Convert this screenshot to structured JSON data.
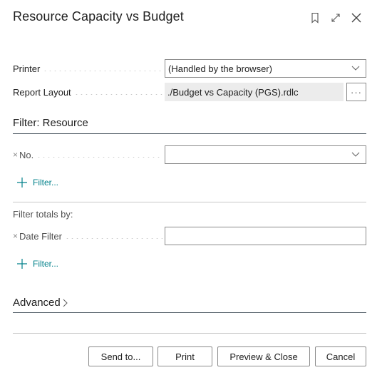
{
  "dialog": {
    "title": "Resource Capacity vs Budget",
    "header_icons": [
      "bookmark-icon",
      "expand-icon",
      "close-icon"
    ]
  },
  "options": {
    "printer": {
      "label": "Printer",
      "value": "(Handled by the browser)"
    },
    "report_layout": {
      "label": "Report Layout",
      "value": "./Budget vs Capacity (PGS).rdlc",
      "action_label": "···"
    }
  },
  "filter_resource": {
    "title": "Filter: Resource",
    "fields": [
      {
        "remove_glyph": "×",
        "label": "No.",
        "value": ""
      }
    ],
    "add_filter_label": "Filter..."
  },
  "filter_totals": {
    "title": "Filter totals by:",
    "fields": [
      {
        "remove_glyph": "×",
        "label": "Date Filter",
        "value": ""
      }
    ],
    "add_filter_label": "Filter..."
  },
  "advanced": {
    "title": "Advanced",
    "chevron": "›"
  },
  "footer": {
    "send_to": "Send to...",
    "print": "Print",
    "preview_close": "Preview & Close",
    "cancel": "Cancel"
  },
  "colors": {
    "accent": "#00808a",
    "readonly_bg": "#ececec",
    "border": "#8a8a8a",
    "section_rule": "#505c66"
  }
}
